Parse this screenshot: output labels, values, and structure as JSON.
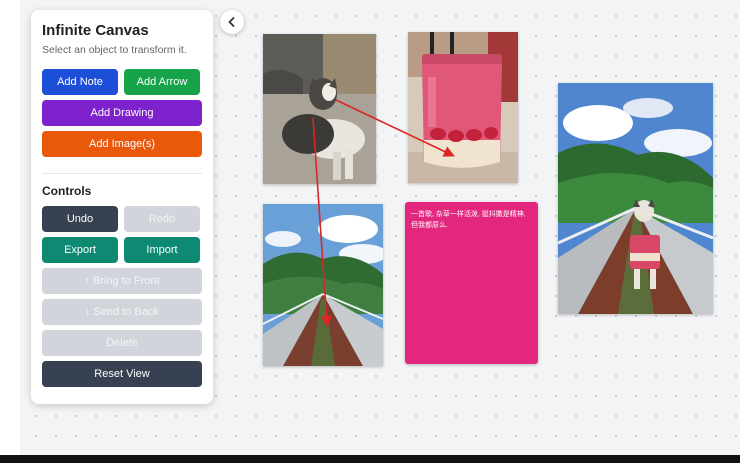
{
  "panel": {
    "title": "Infinite Canvas",
    "subtitle": "Select an object to transform it.",
    "add_note": "Add Note",
    "add_arrow": "Add Arrow",
    "add_drawing": "Add Drawing",
    "add_images": "Add Image(s)",
    "controls_title": "Controls",
    "undo": "Undo",
    "redo": "Redo",
    "export": "Export",
    "import": "Import",
    "bring_to_front": "↑ Bring to Front",
    "send_to_back": "↓ Send to Back",
    "delete": "Delete",
    "reset_view": "Reset View"
  },
  "note": {
    "text": "一首歌, 杂草一样活泼, 挺抖擞是精神, 但我都原么."
  },
  "colors": {
    "note": "#e3267e",
    "arrow": "#dc2626",
    "primary": "#1d4ed8",
    "success": "#16a34a"
  },
  "icons": {
    "collapse": "chevron-left-icon"
  }
}
